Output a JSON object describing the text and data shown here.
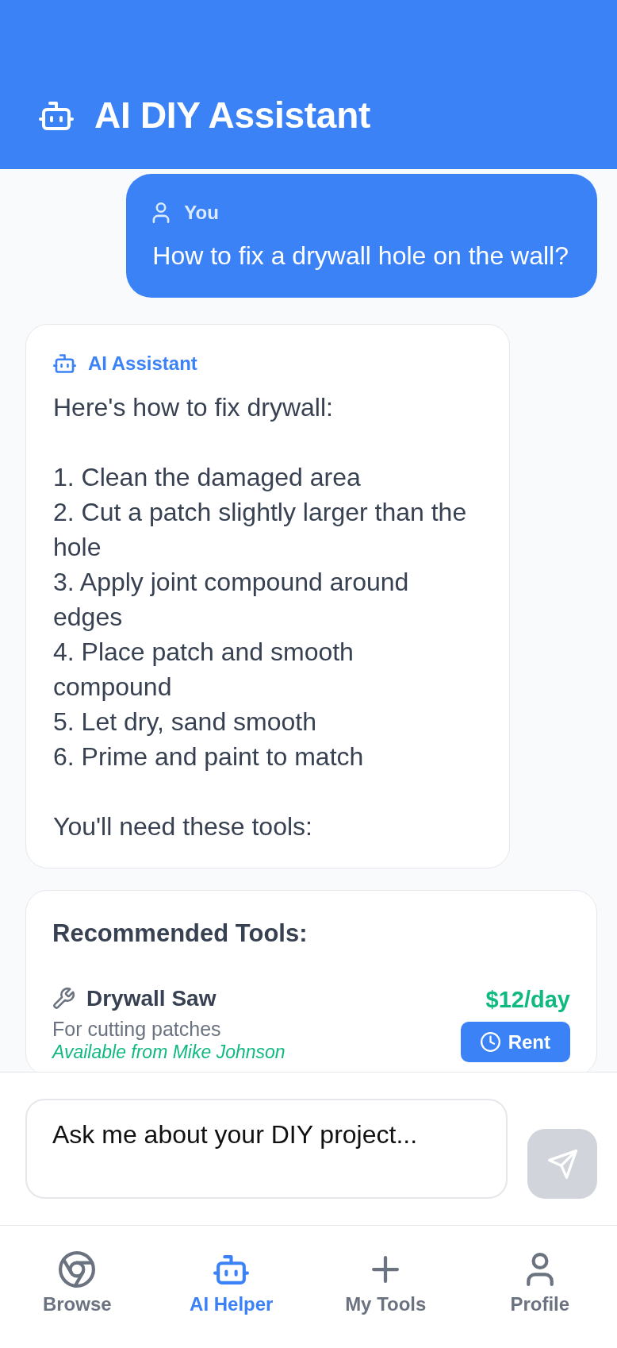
{
  "header": {
    "title": "AI DIY Assistant"
  },
  "messages": [
    {
      "kind": "user",
      "sender": "You",
      "text": "How to fix a drywall hole on the wall?"
    },
    {
      "kind": "assistant",
      "sender": "AI Assistant",
      "text": "Here's how to fix drywall:\n\n1. Clean the damaged area\n2. Cut a patch slightly larger than the hole\n3. Apply joint compound around edges\n4. Place patch and smooth compound\n5. Let dry, sand smooth\n6. Prime and paint to match\n\nYou'll need these tools:"
    }
  ],
  "recommended_tools": {
    "title": "Recommended Tools:",
    "items": [
      {
        "name": "Drywall Saw",
        "description": "For cutting patches",
        "availability": "Available from Mike Johnson",
        "price": "$12/day",
        "action": "Rent"
      }
    ]
  },
  "composer": {
    "placeholder": "Ask me about your DIY project...",
    "send_button": {
      "disabled": true
    }
  },
  "nav": {
    "items": [
      {
        "kind": "browse",
        "label": "Browse",
        "selected": false
      },
      {
        "kind": "assistant",
        "label": "AI Helper",
        "selected": true
      },
      {
        "kind": "add",
        "label": "My Tools",
        "selected": false
      },
      {
        "kind": "profile",
        "label": "Profile",
        "selected": false
      }
    ]
  }
}
